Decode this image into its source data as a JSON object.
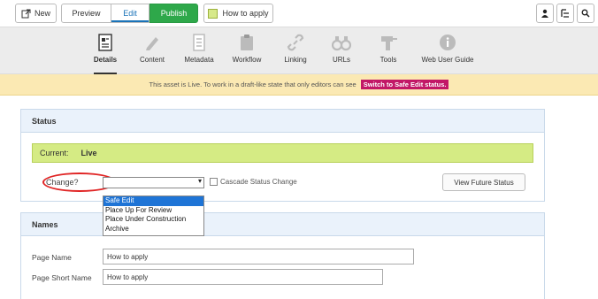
{
  "toolbar": {
    "new_label": "New",
    "preview_label": "Preview",
    "edit_label": "Edit",
    "publish_label": "Publish",
    "asset_label": "How to apply",
    "swatch_color": "#d7e98a"
  },
  "tabs": [
    {
      "label": "Details",
      "icon": "details-icon",
      "active": true
    },
    {
      "label": "Content",
      "icon": "pencil-icon"
    },
    {
      "label": "Metadata",
      "icon": "document-icon"
    },
    {
      "label": "Workflow",
      "icon": "clipboard-icon"
    },
    {
      "label": "Linking",
      "icon": "link-icon"
    },
    {
      "label": "URLs",
      "icon": "binoculars-icon"
    },
    {
      "label": "Tools",
      "icon": "drill-icon"
    },
    {
      "label": "Web User Guide",
      "icon": "info-icon"
    }
  ],
  "alert": {
    "message": "This asset is Live. To work in a draft-like state that only editors can see",
    "link": "Switch to Safe Edit status."
  },
  "status_panel": {
    "title": "Status",
    "current_label": "Current:",
    "current_value": "Live",
    "change_label": "Change?",
    "cascade_label": "Cascade Status Change",
    "future_button": "View Future Status",
    "options": [
      "Safe Edit",
      "Place Up For Review",
      "Place Under Construction",
      "Archive"
    ],
    "selected_option": "Safe Edit"
  },
  "names_panel": {
    "title": "Names",
    "page_name_label": "Page Name",
    "page_name_value": "How to apply",
    "short_name_label": "Page Short Name",
    "short_name_value": "How to apply"
  },
  "colors": {
    "publish": "#2ea84a",
    "live_bar": "#d5eb84",
    "alert_bg": "#fbe9b3",
    "alert_link": "#c21867",
    "oval": "#e02424"
  }
}
